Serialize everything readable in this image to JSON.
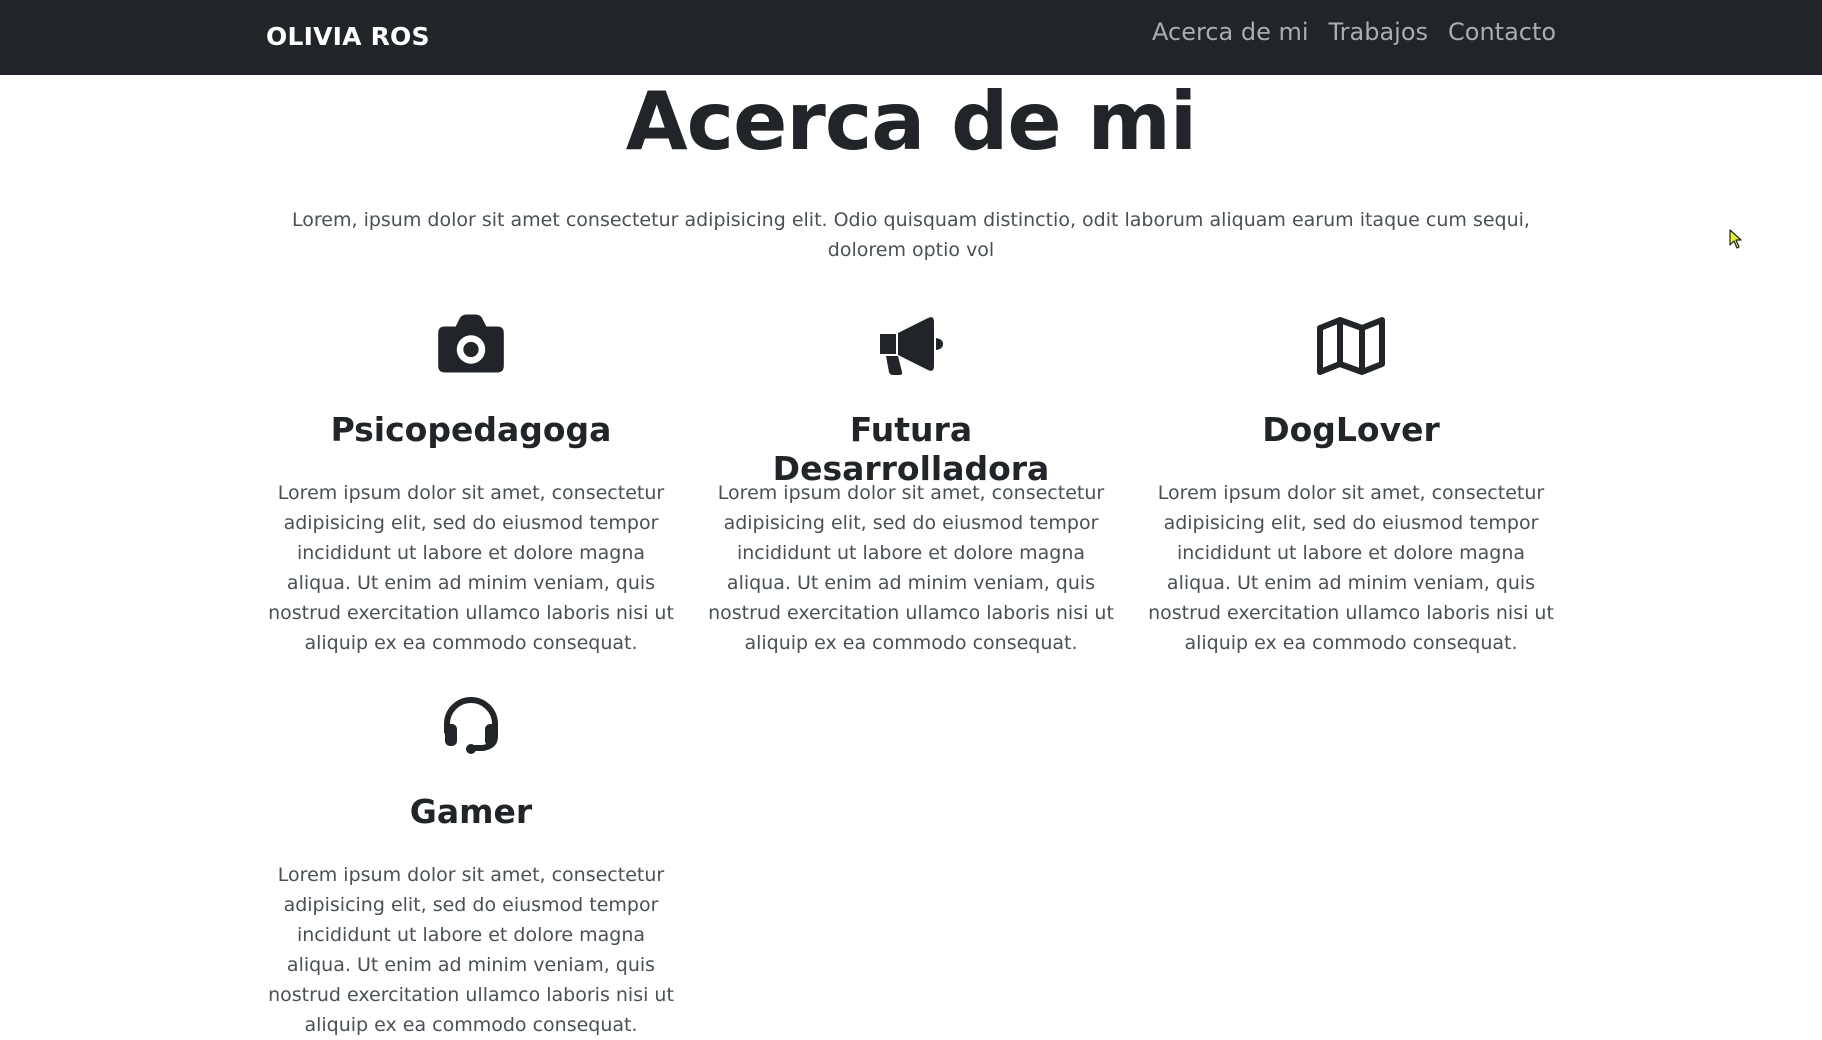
{
  "navbar": {
    "brand": "OLIVIA ROS",
    "links": [
      "Acerca de mi",
      "Trabajos",
      "Contacto"
    ]
  },
  "main": {
    "title": "Acerca de mi",
    "lead": "Lorem, ipsum dolor sit amet consectetur adipisicing elit. Odio quisquam distinctio, odit laborum aliquam earum itaque cum sequi, dolorem optio vol"
  },
  "features": [
    {
      "icon": "camera-icon",
      "title": "Psicopedagoga",
      "text": "Lorem ipsum dolor sit amet, consectetur adipisicing elit, sed do eiusmod tempor incididunt ut labore et dolore magna aliqua. Ut enim ad minim veniam, quis nostrud exercitation ullamco laboris nisi ut aliquip ex ea commodo consequat."
    },
    {
      "icon": "megaphone-icon",
      "title": "Futura Desarrolladora",
      "text": "Lorem ipsum dolor sit amet, consectetur adipisicing elit, sed do eiusmod tempor incididunt ut labore et dolore magna aliqua. Ut enim ad minim veniam, quis nostrud exercitation ullamco laboris nisi ut aliquip ex ea commodo consequat."
    },
    {
      "icon": "map-icon",
      "title": "DogLover",
      "text": "Lorem ipsum dolor sit amet, consectetur adipisicing elit, sed do eiusmod tempor incididunt ut labore et dolore magna aliqua. Ut enim ad minim veniam, quis nostrud exercitation ullamco laboris nisi ut aliquip ex ea commodo consequat."
    },
    {
      "icon": "headset-icon",
      "title": "Gamer",
      "text": "Lorem ipsum dolor sit amet, consectetur adipisicing elit, sed do eiusmod tempor incididunt ut labore et dolore magna aliqua. Ut enim ad minim veniam, quis nostrud exercitation ullamco laboris nisi ut aliquip ex ea commodo consequat."
    }
  ],
  "colors": {
    "navbar": "#212529",
    "heading": "#212529",
    "body_text": "#495057",
    "nav_link": "#a9adb1"
  }
}
